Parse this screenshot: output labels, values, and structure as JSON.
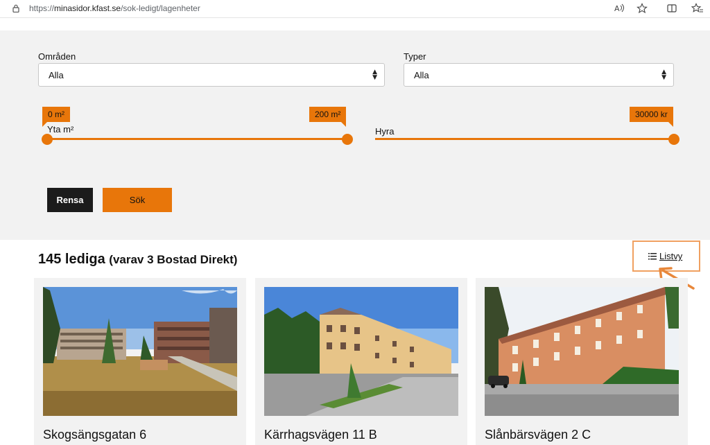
{
  "browser": {
    "url_prefix": "https://",
    "url_domain": "minasidor.kfast.se",
    "url_path": "/sok-ledigt/lagenheter"
  },
  "filters": {
    "areas_label": "Områden",
    "areas_value": "Alla",
    "types_label": "Typer",
    "types_value": "Alla",
    "size": {
      "label": "Yta m²",
      "min_label": "0 m²",
      "max_label": "200 m²",
      "min": 0,
      "max": 200,
      "selected_min": 0,
      "selected_max": 200
    },
    "rent": {
      "label": "Hyra",
      "max_label": "30000 kr",
      "min": 0,
      "max": 30000,
      "selected_max": 30000
    },
    "clear_label": "Rensa",
    "search_label": "Sök"
  },
  "results": {
    "count_text": "145 lediga",
    "sub_text": "(varav 3 Bostad Direkt)",
    "list_view_label": "Listvy",
    "cards": [
      {
        "title": "Skogsängsgatan 6"
      },
      {
        "title": "Kärrhagsvägen 11 B"
      },
      {
        "title": "Slånbärsvägen 2 C"
      }
    ]
  },
  "colors": {
    "accent": "#e8760a",
    "panel": "#f2f2f2",
    "dark_button": "#1b1b1b",
    "highlight": "#f0a060"
  }
}
